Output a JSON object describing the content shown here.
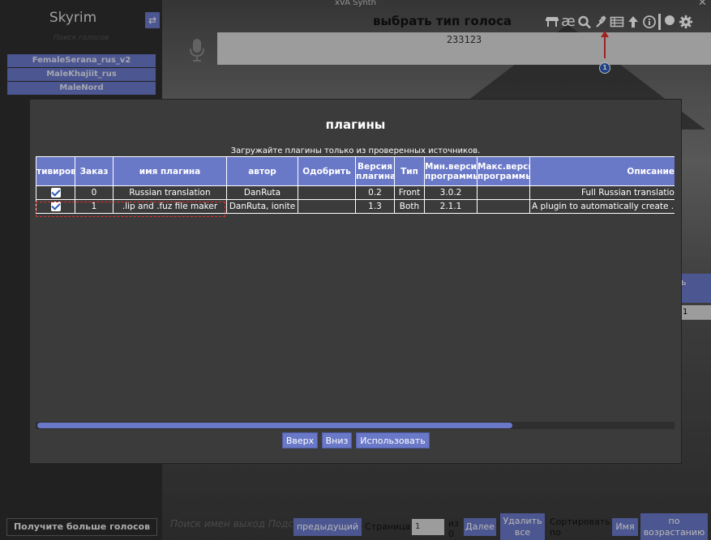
{
  "window": {
    "title": "xVA Synth",
    "close_glyph": "✕"
  },
  "left_panel": {
    "game_title": "Skyrim",
    "search_placeholder": "Поиск голосов",
    "voices": [
      "FemaleSerana_rus_v2",
      "MaleKhajiit_rus",
      "MaleNord"
    ],
    "get_more_label": "Получите больше голосов"
  },
  "main": {
    "voice_type_title": "выбрать тип голоса",
    "text_value": "233123",
    "badge_count": "1",
    "side_button": "ь",
    "side_field_value": "1"
  },
  "toolbar": {
    "icons": [
      "store-icon",
      "ae-icon",
      "search-icon",
      "plugin-icon",
      "batch-icon",
      "upload-icon",
      "info-icon",
      "patreon-icon",
      "gear-icon"
    ],
    "ae_glyph": "æ"
  },
  "bottom_bar": {
    "search_placeholder": "Поиск имен выход Подсказки",
    "prev_label": "предыдущий",
    "page_label": "Страница",
    "page_value": "1",
    "of_label": "из 0",
    "next_label": "Далее",
    "delete_all_label": "Удалить все",
    "sort_by_label": "Сортировать по",
    "name_label": "Имя",
    "ascending_label": "по возрастанию"
  },
  "modal": {
    "title": "плагины",
    "warning": "Загружайте плагины только из проверенных источников.",
    "columns": [
      "тивиров",
      "Заказ",
      "имя плагина",
      "автор",
      "Одобрить",
      "Версия плагина",
      "Тип",
      "Мин.версия программы",
      "Макс.версия программы",
      "Описание"
    ],
    "rows": [
      {
        "enabled": true,
        "order": "0",
        "name": "Russian translation",
        "author": "DanRuta",
        "approve": "",
        "version": "0.2",
        "type": "Front",
        "min_version": "3.0.2",
        "max_version": "",
        "description": "Full Russian translation"
      },
      {
        "enabled": true,
        "order": "1",
        "name": ".lip and .fuz file maker",
        "author": "DanRuta, ionite",
        "approve": "",
        "version": "1.3",
        "type": "Both",
        "min_version": "2.1.1",
        "max_version": "",
        "description": "A plugin to automatically create .lip and .fuz files"
      }
    ],
    "buttons": {
      "up": "Вверх",
      "down": "Вниз",
      "use": "Использовать"
    }
  },
  "colors": {
    "accent": "#6a78c8",
    "highlight": "#e03030",
    "badge": "#2a5cb8"
  }
}
